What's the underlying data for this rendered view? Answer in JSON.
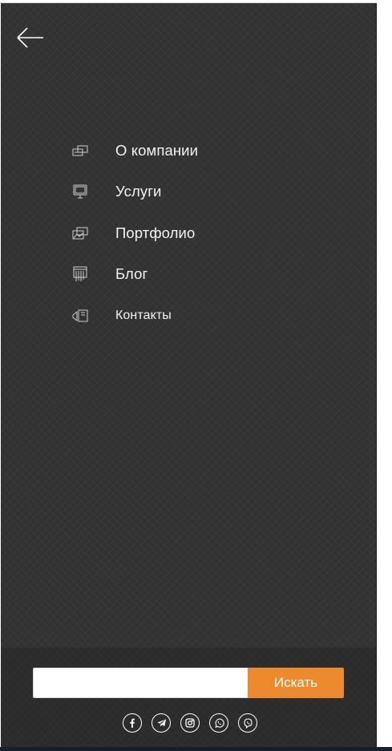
{
  "navigation": {
    "back_icon": "arrow-left-icon",
    "items": [
      {
        "label": "О компании",
        "icon": "company-icon"
      },
      {
        "label": "Услуги",
        "icon": "services-icon"
      },
      {
        "label": "Портфолио",
        "icon": "portfolio-icon"
      },
      {
        "label": "Блог",
        "icon": "blog-icon"
      },
      {
        "label": "Контакты",
        "icon": "contacts-icon"
      }
    ]
  },
  "search": {
    "value": "",
    "placeholder": "",
    "button_label": "Искать",
    "button_color": "#ee8a2e"
  },
  "socials": [
    {
      "icon": "facebook-icon"
    },
    {
      "icon": "telegram-icon"
    },
    {
      "icon": "instagram-icon"
    },
    {
      "icon": "whatsapp-icon"
    },
    {
      "icon": "viber-icon"
    }
  ],
  "colors": {
    "panel_background": "#323232",
    "footer_background": "#2b2b2b",
    "text": "#f2f2f2"
  }
}
